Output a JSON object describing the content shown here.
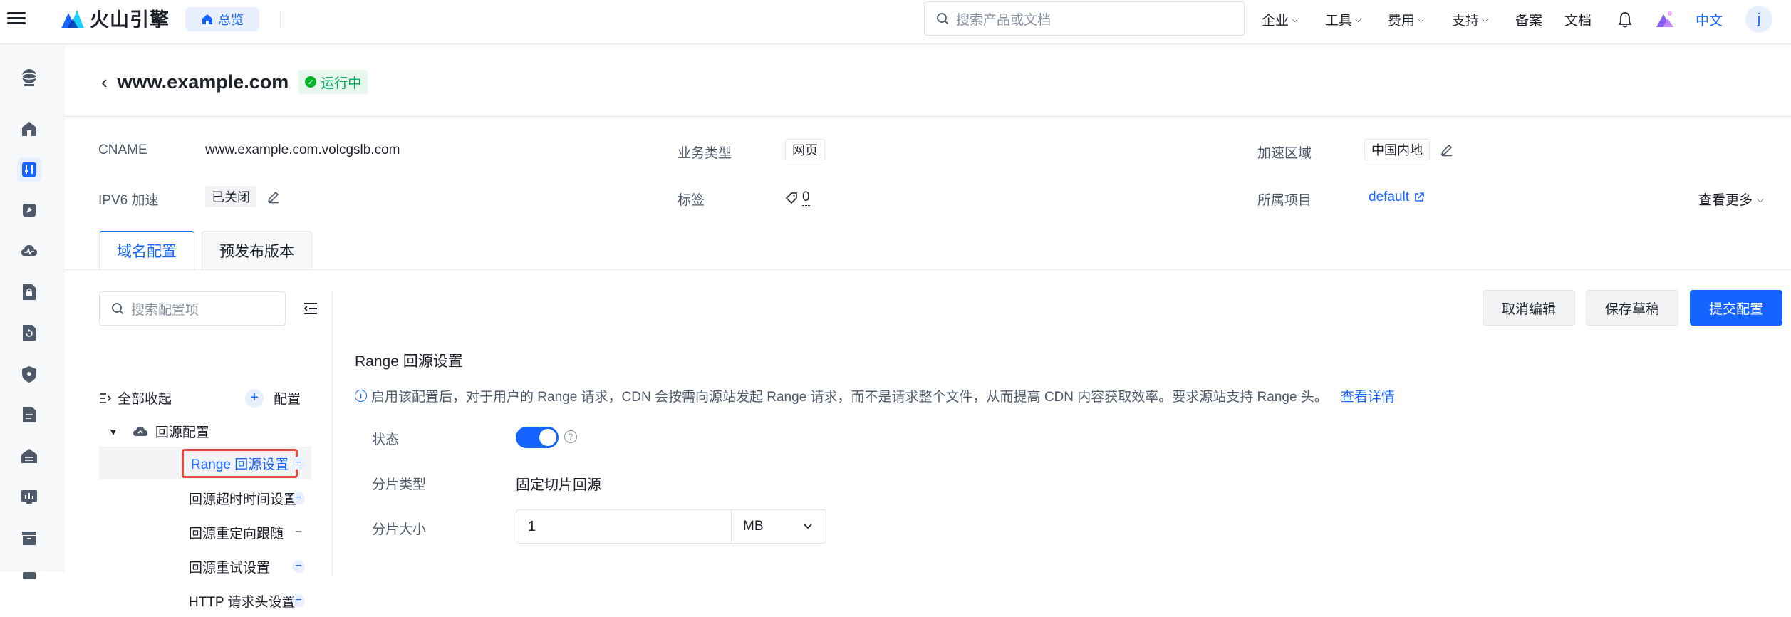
{
  "topbar": {
    "brand": "火山引擎",
    "overview_label": "总览",
    "search_placeholder": "搜索产品或文档",
    "nav": [
      "企业",
      "工具",
      "费用",
      "支持",
      "备案",
      "文档"
    ],
    "lang": "中文",
    "user_initial": "j"
  },
  "page": {
    "domain": "www.example.com",
    "status": "运行中"
  },
  "info": {
    "cname_label": "CNAME",
    "cname_value": "www.example.com.volcgslb.com",
    "biz_type_label": "业务类型",
    "biz_type_value": "网页",
    "region_label": "加速区域",
    "region_value": "中国内地",
    "ipv6_label": "IPV6 加速",
    "ipv6_value": "已关闭",
    "tag_label": "标签",
    "tag_count": "0",
    "project_label": "所属项目",
    "project_value": "default",
    "more": "查看更多"
  },
  "tabs": [
    "域名配置",
    "预发布版本"
  ],
  "config_panel": {
    "search_placeholder": "搜索配置项",
    "collapse_all": "全部收起",
    "add_config": "配置",
    "group": "回源配置",
    "items": [
      "Range 回源设置",
      "回源超时时间设置",
      "回源重定向跟随",
      "回源重试设置",
      "HTTP 请求头设置"
    ]
  },
  "actions": {
    "cancel": "取消编辑",
    "save_draft": "保存草稿",
    "submit": "提交配置"
  },
  "detail": {
    "title": "Range 回源设置",
    "hint": "启用该配置后，对于用户的 Range 请求，CDN 会按需向源站发起 Range 请求，而不是请求整个文件，从而提高 CDN 内容获取效率。要求源站支持 Range 头。",
    "hint_link": "查看详情",
    "status_label": "状态",
    "status_enabled": true,
    "slice_type_label": "分片类型",
    "slice_type_value": "固定切片回源",
    "slice_size_label": "分片大小",
    "slice_size_value": "1",
    "slice_unit": "MB"
  },
  "colors": {
    "accent": "#1664ff",
    "success": "#00b42a",
    "highlight_border": "#e8473c"
  }
}
